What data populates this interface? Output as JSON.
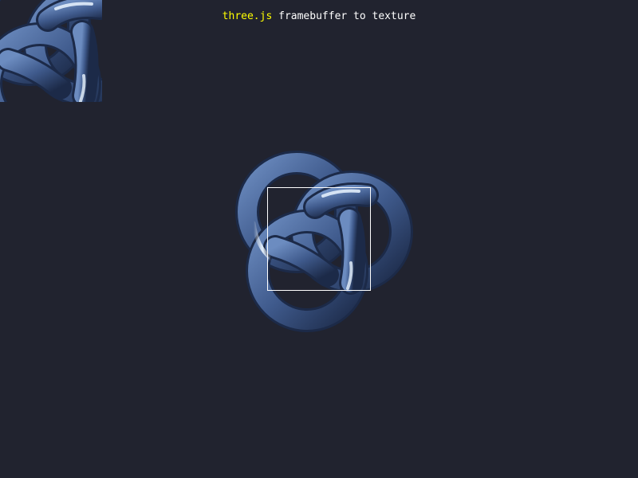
{
  "info": {
    "link_text": "three.js",
    "caption": " framebuffer to texture"
  },
  "scene": {
    "background_color": "#21232f",
    "object": "torus-knot",
    "material_color": "#3f5a8c",
    "highlight_color": "#e8f4ff"
  },
  "thumbnail": {
    "description_icon": "render-texture-preview"
  },
  "selection": {
    "border_color": "#ffffff"
  }
}
